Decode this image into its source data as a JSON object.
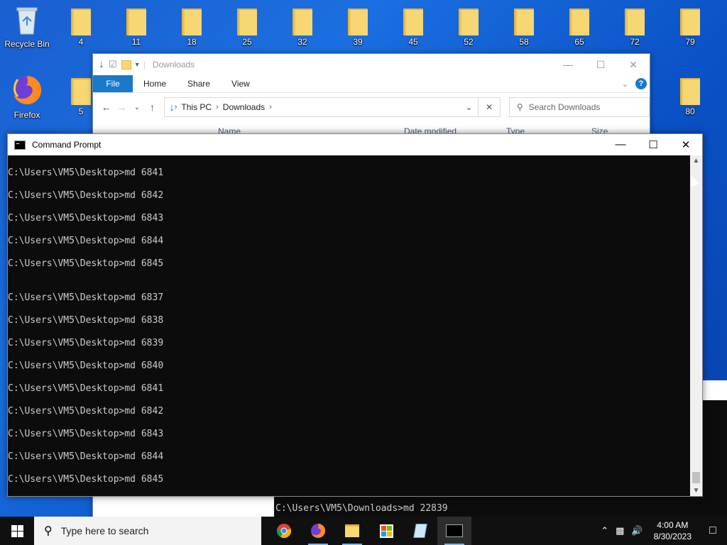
{
  "desktop": {
    "icons": [
      {
        "label": "Recycle Bin",
        "kind": "recycle-bin-icon"
      },
      {
        "label": "Firefox",
        "kind": "firefox-icon"
      },
      {
        "label": "4"
      },
      {
        "label": "11"
      },
      {
        "label": "18"
      },
      {
        "label": "25"
      },
      {
        "label": "32"
      },
      {
        "label": "39"
      },
      {
        "label": "45"
      },
      {
        "label": "52"
      },
      {
        "label": "58"
      },
      {
        "label": "65"
      },
      {
        "label": "72"
      },
      {
        "label": "79"
      },
      {
        "label": "5"
      },
      {
        "label": "80"
      }
    ]
  },
  "explorer": {
    "title": "Downloads",
    "ribbon": {
      "file": "File",
      "home": "Home",
      "share": "Share",
      "view": "View"
    },
    "breadcrumb": [
      "This PC",
      "Downloads"
    ],
    "search_placeholder": "Search Downloads",
    "columns": [
      "Name",
      "Date modified",
      "Type",
      "Size"
    ]
  },
  "cmd": {
    "title": "Command Prompt",
    "lines": [
      "C:\\Users\\VM5\\Desktop>md 6841",
      "C:\\Users\\VM5\\Desktop>md 6842",
      "C:\\Users\\VM5\\Desktop>md 6843",
      "C:\\Users\\VM5\\Desktop>md 6844",
      "C:\\Users\\VM5\\Desktop>md 6845",
      "C:\\Users\\VM5\\Desktop>md 6837",
      "C:\\Users\\VM5\\Desktop>md 6838",
      "C:\\Users\\VM5\\Desktop>md 6839",
      "C:\\Users\\VM5\\Desktop>md 6840",
      "C:\\Users\\VM5\\Desktop>md 6841",
      "C:\\Users\\VM5\\Desktop>md 6842",
      "C:\\Users\\VM5\\Desktop>md 6843",
      "C:\\Users\\VM5\\Desktop>md 6844",
      "C:\\Users\\VM5\\Desktop>md 6845"
    ]
  },
  "cmd2": {
    "line": "C:\\Users\\VM5\\Downloads>md 22839"
  },
  "taskbar": {
    "search_placeholder": "Type here to search",
    "time": "4:00 AM",
    "date": "8/30/2023"
  },
  "colors": {
    "accent": "#1979ca",
    "terminal_bg": "#0c0c0c",
    "terminal_fg": "#cccccc"
  }
}
